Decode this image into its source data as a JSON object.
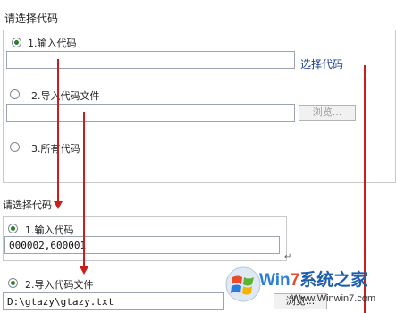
{
  "top": {
    "title": "请选择代码",
    "option1": "1.输入代码",
    "option2": "2.导入代码文件",
    "option3": "3.所有代码",
    "select_link": "选择代码",
    "browse": "浏览..."
  },
  "bottom": {
    "title": "请选择代码",
    "option1": "1.输入代码",
    "code_value": "000002,600001",
    "option2": "2.导入代码文件",
    "file_value": "D:\\gtazy\\gtazy.txt",
    "browse": "浏览..."
  },
  "watermark": {
    "brand_w": "W",
    "brand_in": "in",
    "brand_7": "7",
    "brand_cn": "系统之家",
    "url": "Www.Winwin7.com"
  },
  "colors": {
    "arrow": "#cc1d1d",
    "radio_checked": "#2d7d2d",
    "link": "#1f3f8f"
  },
  "icons": [
    "windows-logo-icon",
    "red-arrow-icon"
  ]
}
